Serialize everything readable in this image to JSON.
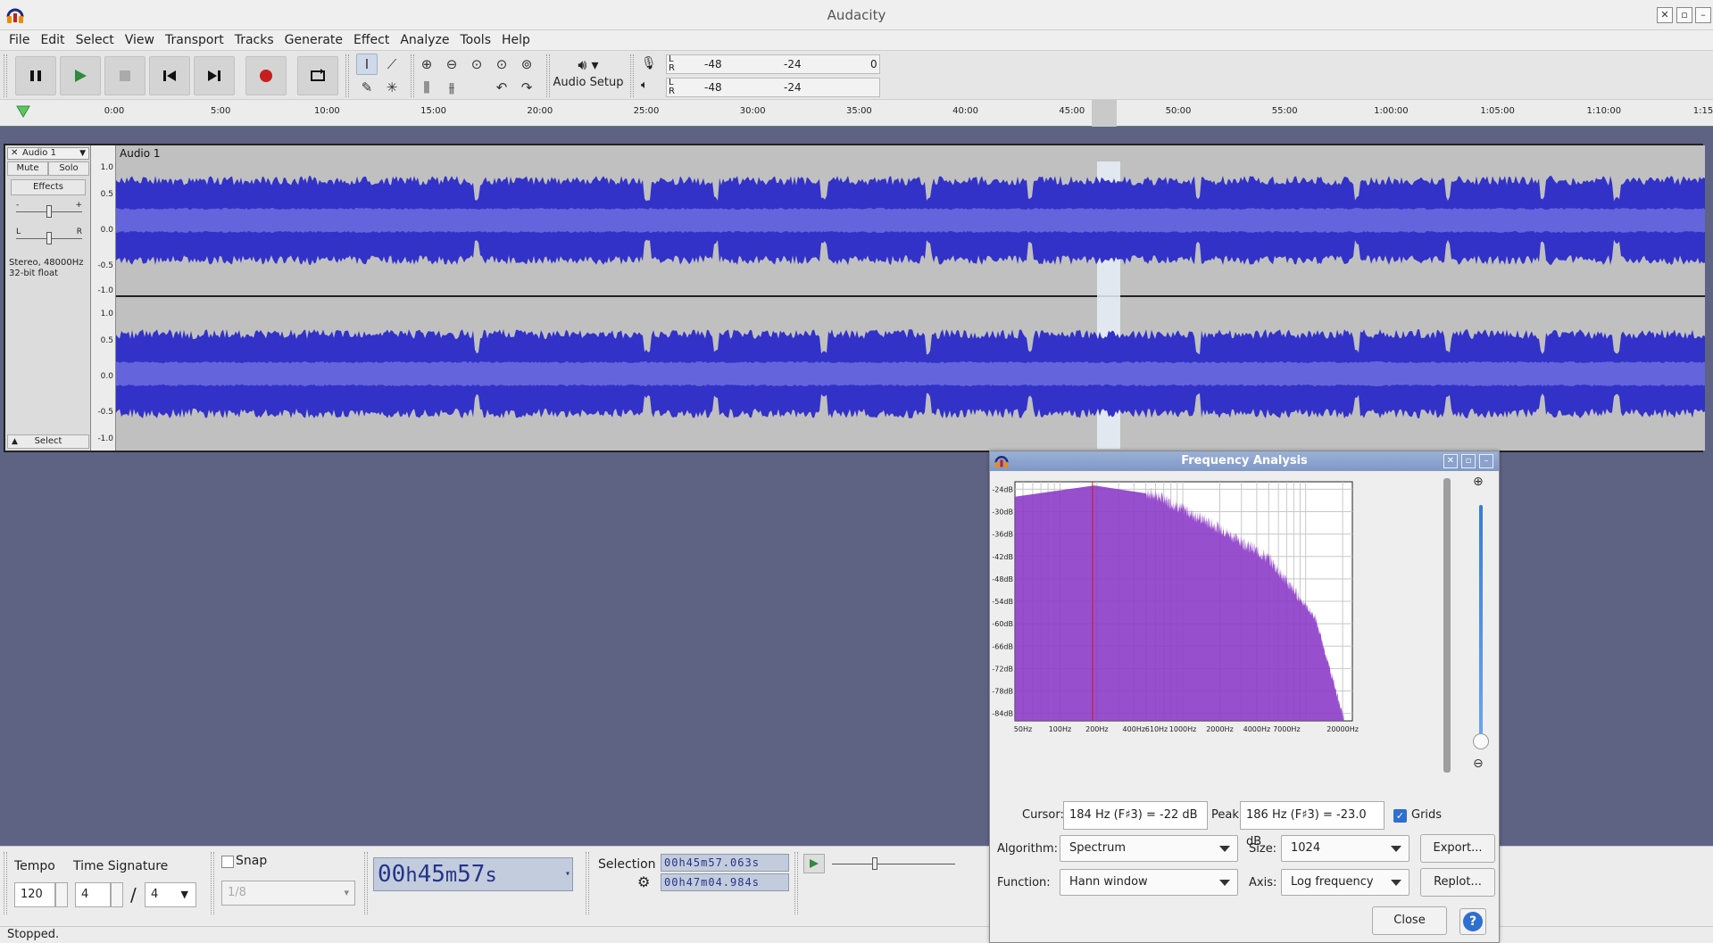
{
  "window": {
    "title": "Audacity"
  },
  "menu": [
    "File",
    "Edit",
    "Select",
    "View",
    "Transport",
    "Tracks",
    "Generate",
    "Effect",
    "Analyze",
    "Tools",
    "Help"
  ],
  "toolbar": {
    "audio_setup_label": "Audio Setup",
    "record_meter": {
      "l": "L",
      "r": "R",
      "ticks": [
        "-48",
        "-24",
        "0"
      ]
    },
    "play_meter": {
      "l": "L",
      "r": "R",
      "ticks": [
        "-48",
        "-24"
      ]
    }
  },
  "timeline": {
    "ticks": [
      "0:00",
      "5:00",
      "10:00",
      "15:00",
      "20:00",
      "25:00",
      "30:00",
      "35:00",
      "40:00",
      "45:00",
      "50:00",
      "55:00",
      "1:00:00",
      "1:05:00",
      "1:10:00",
      "1:15:00"
    ]
  },
  "track": {
    "name": "Audio 1",
    "clip_title": "Audio 1",
    "mute": "Mute",
    "solo": "Solo",
    "effects": "Effects",
    "gain_minus": "-",
    "gain_plus": "+",
    "pan_l": "L",
    "pan_r": "R",
    "info_line1": "Stereo, 48000Hz",
    "info_line2": "32-bit float",
    "select": "Select",
    "vruler": [
      "1.0",
      "0.5",
      "0.0",
      "-0.5",
      "-1.0"
    ],
    "colors": {
      "wave": "#3232c8",
      "rms": "#6464dc"
    }
  },
  "bottom": {
    "tempo_label": "Tempo",
    "tempo_value": "120",
    "timesig_label": "Time Signature",
    "timesig_num": "4",
    "timesig_sep": "/",
    "timesig_den": "4",
    "snap_label": "Snap",
    "snap_value": "1/8",
    "time_display": {
      "d1": "0",
      "d2": "0",
      "h": "h",
      "d3": "4",
      "d4": "5",
      "m": "m",
      "d5": "5",
      "d6": "7",
      "s": "s"
    },
    "selection_label": "Selection",
    "selection_start": "00h45m57.063s",
    "selection_end": "00h47m04.984s"
  },
  "status": "Stopped.",
  "dialog": {
    "title": "Frequency Analysis",
    "db_labels": [
      "-24dB",
      "-30dB",
      "-36dB",
      "-42dB",
      "-48dB",
      "-54dB",
      "-60dB",
      "-66dB",
      "-72dB",
      "-78dB",
      "-84dB"
    ],
    "freq_labels": [
      "50Hz",
      "100Hz",
      "200Hz",
      "400Hz",
      "610Hz",
      "1000Hz",
      "2000Hz",
      "4000Hz",
      "7000Hz",
      "20000Hz"
    ],
    "cursor_label": "Cursor:",
    "cursor_value": "184 Hz (F♯3) = -22 dB",
    "peak_label": "Peak:",
    "peak_value": "186 Hz (F♯3) = -23.0 dB",
    "grids_label": "Grids",
    "algorithm_label": "Algorithm:",
    "algorithm_value": "Spectrum",
    "size_label": "Size:",
    "size_value": "1024",
    "export_label": "Export...",
    "function_label": "Function:",
    "function_value": "Hann window",
    "axis_label": "Axis:",
    "axis_value": "Log frequency",
    "replot_label": "Replot...",
    "close_label": "Close",
    "help_label": "?",
    "colors": {
      "spectrum": "#8c3cc8",
      "cursor": "#c81e1e"
    }
  }
}
